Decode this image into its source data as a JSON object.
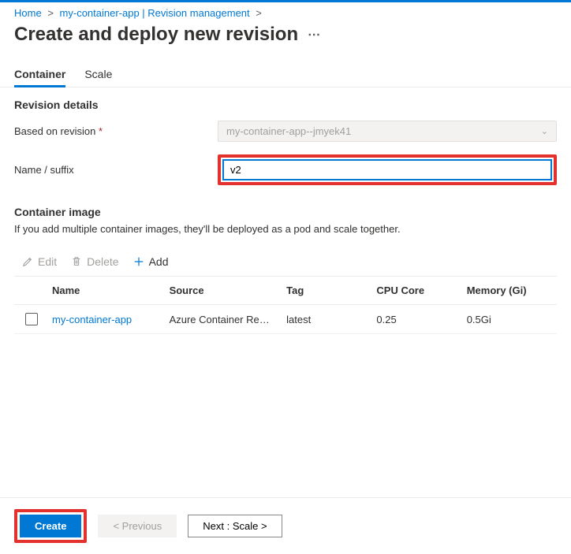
{
  "breadcrumb": {
    "home": "Home",
    "app": "my-container-app | Revision management"
  },
  "page": {
    "title": "Create and deploy new revision"
  },
  "tabs": {
    "container": "Container",
    "scale": "Scale"
  },
  "revision": {
    "section_title": "Revision details",
    "based_on_label": "Based on revision",
    "based_on_value": "my-container-app--jmyek41",
    "suffix_label": "Name / suffix",
    "suffix_value": "v2"
  },
  "image": {
    "section_title": "Container image",
    "helper": "If you add multiple container images, they'll be deployed as a pod and scale together."
  },
  "toolbar": {
    "edit": "Edit",
    "delete": "Delete",
    "add": "Add"
  },
  "table": {
    "headers": {
      "name": "Name",
      "source": "Source",
      "tag": "Tag",
      "cpu": "CPU Core",
      "memory": "Memory (Gi)"
    },
    "row0": {
      "name": "my-container-app",
      "source": "Azure Container Re…",
      "tag": "latest",
      "cpu": "0.25",
      "memory": "0.5Gi"
    }
  },
  "footer": {
    "create": "Create",
    "prev": "< Previous",
    "next": "Next : Scale >"
  }
}
